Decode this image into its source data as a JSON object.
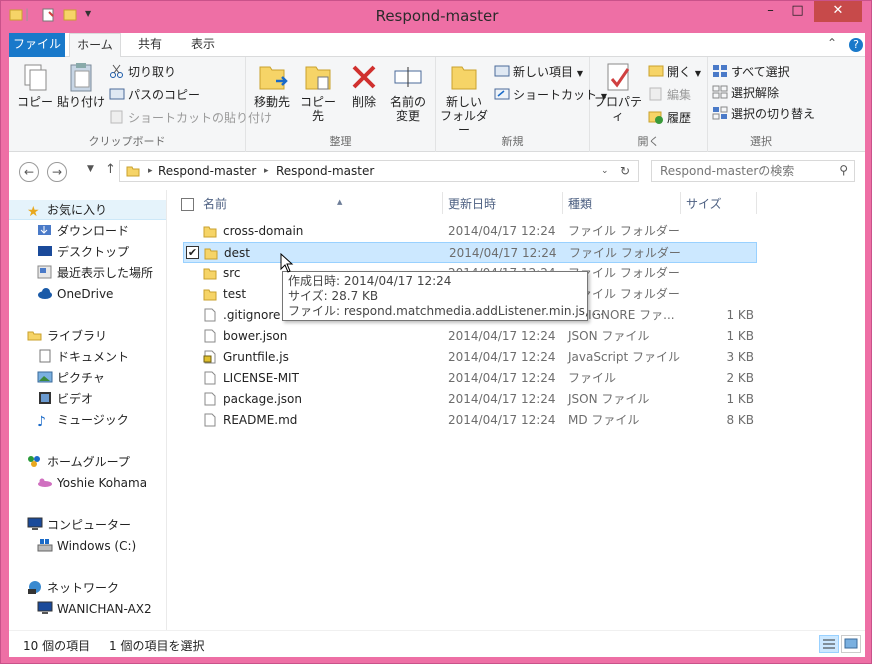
{
  "window": {
    "title": "Respond-master"
  },
  "caption": {
    "min": "–",
    "max": "□",
    "close": "✕"
  },
  "tabs": {
    "file": "ファイル",
    "home": "ホーム",
    "share": "共有",
    "view": "表示"
  },
  "ribbon": {
    "clipboard": {
      "label": "クリップボード",
      "copy": "コピー",
      "paste": "貼り付け",
      "cut": "切り取り",
      "copy_path": "パスのコピー",
      "paste_shortcut": "ショートカットの貼り付け"
    },
    "organize": {
      "label": "整理",
      "move_to": "移動先",
      "copy_to": "コピー先",
      "delete": "削除",
      "rename_1": "名前の",
      "rename_2": "変更"
    },
    "new": {
      "label": "新規",
      "new_folder_1": "新しい",
      "new_folder_2": "フォルダー",
      "new_item": "新しい項目",
      "easy_access": "ショートカット"
    },
    "open": {
      "label": "開く",
      "properties": "プロパティ",
      "open": "開く",
      "edit": "編集",
      "history": "履歴"
    },
    "select": {
      "label": "選択",
      "select_all": "すべて選択",
      "select_none": "選択解除",
      "invert": "選択の切り替え"
    }
  },
  "address": {
    "crumbs": [
      "Respond-master",
      "Respond-master"
    ],
    "search_placeholder": "Respond-masterの検索"
  },
  "navpane": {
    "favorites": "お気に入り",
    "downloads": "ダウンロード",
    "desktop": "デスクトップ",
    "recent": "最近表示した場所",
    "onedrive": "OneDrive",
    "libraries": "ライブラリ",
    "documents": "ドキュメント",
    "pictures": "ピクチャ",
    "videos": "ビデオ",
    "music": "ミュージック",
    "homegroup": "ホームグループ",
    "homegroup_user": "Yoshie Kohama",
    "computer": "コンピューター",
    "drive_c": "Windows (C:)",
    "network": "ネットワーク",
    "network_pc": "WANICHAN-AX2"
  },
  "columns": {
    "name": "名前",
    "date": "更新日時",
    "type": "種類",
    "size": "サイズ"
  },
  "files": [
    {
      "name": "cross-domain",
      "date": "2014/04/17 12:24",
      "type": "ファイル フォルダー",
      "size": "",
      "icon": "folder-icon"
    },
    {
      "name": "dest",
      "date": "2014/04/17 12:24",
      "type": "ファイル フォルダー",
      "size": "",
      "icon": "folder-icon"
    },
    {
      "name": "src",
      "date": "2014/04/17 12:24",
      "type": "ファイル フォルダー",
      "size": "",
      "icon": "folder-icon"
    },
    {
      "name": "test",
      "date": "2014/04/17 12:24",
      "type": "ファイル フォルダー",
      "size": "",
      "icon": "folder-icon"
    },
    {
      "name": ".gitignore",
      "date": "2014/04/17 12:24",
      "type": "GITIGNORE ファ...",
      "size": "1 KB",
      "icon": "file-icon"
    },
    {
      "name": "bower.json",
      "date": "2014/04/17 12:24",
      "type": "JSON ファイル",
      "size": "1 KB",
      "icon": "file-icon"
    },
    {
      "name": "Gruntfile.js",
      "date": "2014/04/17 12:24",
      "type": "JavaScript ファイル",
      "size": "3 KB",
      "icon": "script-icon"
    },
    {
      "name": "LICENSE-MIT",
      "date": "2014/04/17 12:24",
      "type": "ファイル",
      "size": "2 KB",
      "icon": "file-icon"
    },
    {
      "name": "package.json",
      "date": "2014/04/17 12:24",
      "type": "JSON ファイル",
      "size": "1 KB",
      "icon": "file-icon"
    },
    {
      "name": "README.md",
      "date": "2014/04/17 12:24",
      "type": "MD ファイル",
      "size": "8 KB",
      "icon": "file-icon"
    }
  ],
  "tooltip": {
    "created": "作成日時: 2014/04/17 12:24",
    "size": "サイズ: 28.7 KB",
    "files": "ファイル: respond.matchmedia.addListener.min.js, ..."
  },
  "status": {
    "count": "10 個の項目",
    "selected": "1 個の項目を選択"
  }
}
